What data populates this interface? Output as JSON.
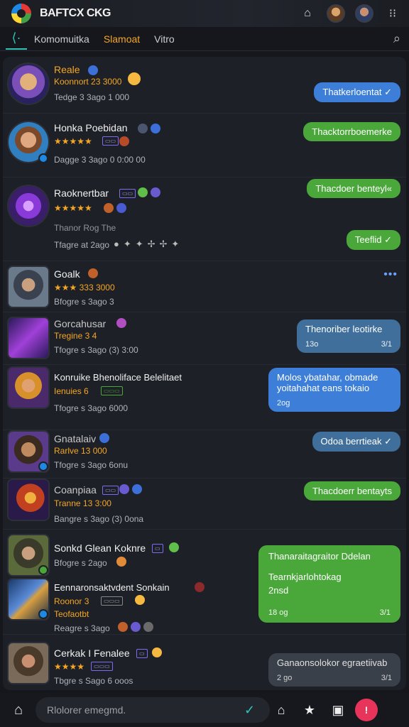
{
  "app": {
    "title": "BAFTCX CKG"
  },
  "tabs": [
    {
      "label": "Komomuitka"
    },
    {
      "label": "Slamoat"
    },
    {
      "label": "Vitro"
    }
  ],
  "chats": [
    {
      "name": "Reale",
      "sub": "Koonnort 23 3000",
      "meta": "Tedge 3 3ago  1 000",
      "bubble": "Thatkerloentat ✓"
    },
    {
      "name": "Honka Poebidan",
      "sub": "★★★★★",
      "meta": "Dagge 3 3ago  0 0:00 00",
      "bubble": "Thacktorrboemerke"
    },
    {
      "name": "Raoknertbar",
      "sub": "★★★★★",
      "meta2": "Thanor Rog The",
      "meta": "Tfagre at 2ago",
      "bubble": "Thacdoer benteyl«",
      "bubble2": "Teeflid ✓"
    },
    {
      "name": "Goalk",
      "sub": "★★★ 333 3000",
      "meta": "Bfogre s 3ago  3",
      "typing": "•••"
    },
    {
      "name": "Gorcahusar",
      "sub": "Tregine 3 4",
      "meta": "Tfogre s 3ago  (3) 3:00",
      "bubble": "Thenoriber leotirke",
      "bubble_time": "13o",
      "bubble_count": "3/1"
    },
    {
      "name": "Konruike Bhenoliface Belelitaet",
      "sub": "Ienuies 6",
      "meta": "Tfogre s 3ago  6000",
      "bubble_l1": "Molos ybatahar, obmade",
      "bubble_l2": "yoitahahat eans tokaio",
      "bubble_time": "2og"
    },
    {
      "name": "Gnatalaiv",
      "sub": "Rarlve 13 000",
      "meta": "Tfogre s 3ago  6onu",
      "bubble": "Odoa berrtieak ✓"
    },
    {
      "name": "Coanpiaa",
      "sub": "Tranne 13 3:00",
      "meta": "Bangre s 3ago  (3) 0ona",
      "bubble": "Thacdoerr bentayts"
    },
    {
      "name": "Sonkd Glean Koknre",
      "sub": "",
      "meta": "Bfogre s 2ago"
    },
    {
      "name": "Eennaronsaktvdent Sonkain",
      "sub": "Roonor 3",
      "meta": "Reagre s 3ago",
      "meta2": "Teofaotbt",
      "bubble_l1": "Thanaraitagraitor Ddelan",
      "bubble_l2": "Tearnkjarlohtokag",
      "bubble_l3": "2nsd",
      "bubble_time": "18 og",
      "bubble_count": "3/1"
    },
    {
      "name": "Cerkak I Fenalee",
      "sub": "★★★★",
      "meta": "Tbgre s Sago  6 ooos",
      "bubble": "Ganaonsolokor egraetiivab",
      "bubble_time": "2 go",
      "bubble_count": "3/1"
    }
  ],
  "composer": {
    "placeholder": "Rlolorer emegmd."
  },
  "colors": {
    "accent": "#2ec4b6",
    "orange": "#f5a623",
    "blue_bubble": "#3d7fd8",
    "green_bubble": "#4aa83a",
    "badge": "#e8345a"
  }
}
